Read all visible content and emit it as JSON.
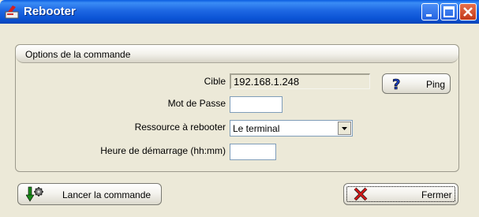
{
  "window": {
    "title": "Rebooter"
  },
  "titlebar_buttons": {
    "minimize_icon": "minimize-icon",
    "maximize_icon": "maximize-icon",
    "close_icon": "close-icon"
  },
  "group": {
    "title": "Options de la commande"
  },
  "form": {
    "cible_label": "Cible",
    "cible_value": "192.168.1.248",
    "password_label": "Mot de Passe",
    "password_value": "",
    "ressource_label": "Ressource à rebooter",
    "ressource_selected": "Le terminal",
    "heure_label": "Heure de démarrage (hh:mm)",
    "heure_value": ""
  },
  "buttons": {
    "ping_label": "Ping",
    "ping_icon": "question-icon",
    "launch_label": "Lancer la commande",
    "launch_icon": "download-gear-icon",
    "close_label": "Fermer",
    "close_icon": "red-x-icon"
  },
  "colors": {
    "titlebar": "#0a52d4",
    "window_bg": "#ece9d8",
    "close_button": "#c2391a"
  }
}
